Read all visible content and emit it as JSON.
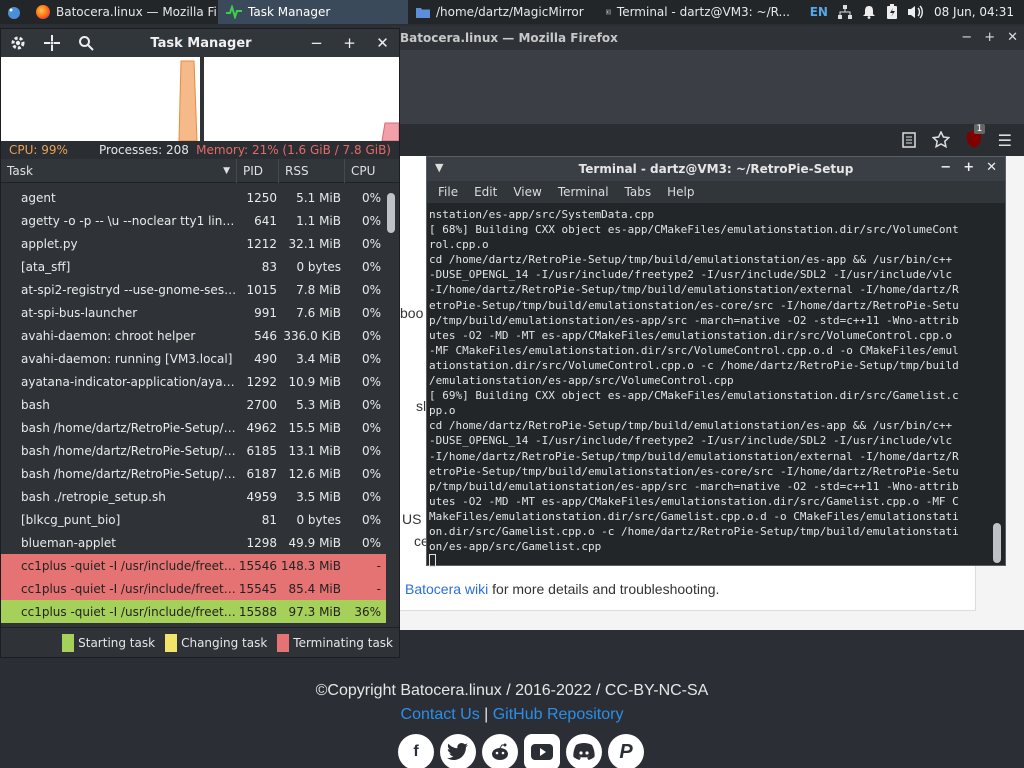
{
  "panel": {
    "tasks": [
      {
        "label": "Batocera.linux — Mozilla Fi...",
        "icon": "firefox-icon",
        "active": false
      },
      {
        "label": "Task Manager",
        "icon": "task-manager-icon",
        "active": true
      },
      {
        "label": "/home/dartz/MagicMirror",
        "icon": "folder-icon",
        "active": false
      },
      {
        "label": "Terminal - dartz@VM3: ~/R...",
        "icon": "terminal-icon",
        "active": false
      }
    ],
    "language": "EN",
    "clock": "08 Jun, 04:31"
  },
  "firefox": {
    "title": "Batocera.linux — Mozilla Firefox",
    "extension_badge": "1",
    "fragments": {
      "boo": "boo",
      "sl": "sl",
      "us": "US",
      "cew": "ce w",
      "link_text": "Batocera wiki",
      "after_link": " for more details and troubleshooting."
    },
    "footer": {
      "copyright": "©Copyright Batocera.linux / 2016-2022 / CC-BY-NC-SA",
      "contact": "Contact Us",
      "separator": " | ",
      "github": "GitHub Repository"
    }
  },
  "taskmanager": {
    "title": "Task Manager",
    "stats": {
      "cpu": "CPU: 99%",
      "processes": "Processes: 208",
      "memory": "Memory: 21% (1.6 GiB / 7.8 GiB)"
    },
    "columns": {
      "task": "Task",
      "pid": "PID",
      "rss": "RSS",
      "cpu": "CPU"
    },
    "rows": [
      {
        "task": "agent",
        "pid": "1250",
        "rss": "5.1 MiB",
        "cpu": "0%",
        "state": ""
      },
      {
        "task": "agetty -o -p -- \\u --noclear tty1 linux",
        "pid": "641",
        "rss": "1.1 MiB",
        "cpu": "0%",
        "state": ""
      },
      {
        "task": "applet.py",
        "pid": "1212",
        "rss": "32.1 MiB",
        "cpu": "0%",
        "state": ""
      },
      {
        "task": "[ata_sff]",
        "pid": "83",
        "rss": "0 bytes",
        "cpu": "0%",
        "state": ""
      },
      {
        "task": "at-spi2-registryd --use-gnome-session",
        "pid": "1015",
        "rss": "7.8 MiB",
        "cpu": "0%",
        "state": ""
      },
      {
        "task": "at-spi-bus-launcher",
        "pid": "991",
        "rss": "7.6 MiB",
        "cpu": "0%",
        "state": ""
      },
      {
        "task": "avahi-daemon: chroot helper",
        "pid": "546",
        "rss": "336.0 KiB",
        "cpu": "0%",
        "state": ""
      },
      {
        "task": "avahi-daemon: running [VM3.local]",
        "pid": "490",
        "rss": "3.4 MiB",
        "cpu": "0%",
        "state": ""
      },
      {
        "task": "ayatana-indicator-application/ayata...",
        "pid": "1292",
        "rss": "10.9 MiB",
        "cpu": "0%",
        "state": ""
      },
      {
        "task": "bash",
        "pid": "2700",
        "rss": "5.3 MiB",
        "cpu": "0%",
        "state": ""
      },
      {
        "task": "bash /home/dartz/RetroPie-Setup/re...",
        "pid": "4962",
        "rss": "15.5 MiB",
        "cpu": "0%",
        "state": ""
      },
      {
        "task": "bash /home/dartz/RetroPie-Setup/re...",
        "pid": "6185",
        "rss": "13.1 MiB",
        "cpu": "0%",
        "state": ""
      },
      {
        "task": "bash /home/dartz/RetroPie-Setup/re...",
        "pid": "6187",
        "rss": "12.6 MiB",
        "cpu": "0%",
        "state": ""
      },
      {
        "task": "bash ./retropie_setup.sh",
        "pid": "4959",
        "rss": "3.5 MiB",
        "cpu": "0%",
        "state": ""
      },
      {
        "task": "[blkcg_punt_bio]",
        "pid": "81",
        "rss": "0 bytes",
        "cpu": "0%",
        "state": ""
      },
      {
        "task": "blueman-applet",
        "pid": "1298",
        "rss": "49.9 MiB",
        "cpu": "0%",
        "state": ""
      },
      {
        "task": "cc1plus -quiet -I /usr/include/freetyp...",
        "pid": "15546",
        "rss": "148.3 MiB",
        "cpu": "-",
        "state": "red"
      },
      {
        "task": "cc1plus -quiet -I /usr/include/freetyp...",
        "pid": "15545",
        "rss": "85.4 MiB",
        "cpu": "-",
        "state": "red"
      },
      {
        "task": "cc1plus -quiet -I /usr/include/freetyp...",
        "pid": "15588",
        "rss": "97.3 MiB",
        "cpu": "36%",
        "state": "green"
      }
    ],
    "legend": {
      "starting": "Starting task",
      "changing": "Changing task",
      "terminating": "Terminating task"
    },
    "colors": {
      "starting": "#a5d15a",
      "changing": "#f2e46a",
      "terminating": "#e57373",
      "cpu_graph": "#f5b98a",
      "mem_graph": "#f2a0a8"
    }
  },
  "terminal": {
    "title": "Terminal - dartz@VM3: ~/RetroPie-Setup",
    "menu": [
      "File",
      "Edit",
      "View",
      "Terminal",
      "Tabs",
      "Help"
    ],
    "lines": [
      "nstation/es-app/src/SystemData.cpp",
      "[ 68%] Building CXX object es-app/CMakeFiles/emulationstation.dir/src/VolumeCont",
      "rol.cpp.o",
      "cd /home/dartz/RetroPie-Setup/tmp/build/emulationstation/es-app && /usr/bin/c++",
      "-DUSE_OPENGL_14 -I/usr/include/freetype2 -I/usr/include/SDL2 -I/usr/include/vlc",
      "-I/home/dartz/RetroPie-Setup/tmp/build/emulationstation/external -I/home/dartz/R",
      "etroPie-Setup/tmp/build/emulationstation/es-core/src -I/home/dartz/RetroPie-Setu",
      "p/tmp/build/emulationstation/es-app/src -march=native -O2 -std=c++11 -Wno-attrib",
      "utes -O2 -MD -MT es-app/CMakeFiles/emulationstation.dir/src/VolumeControl.cpp.o",
      "-MF CMakeFiles/emulationstation.dir/src/VolumeControl.cpp.o.d -o CMakeFiles/emul",
      "ationstation.dir/src/VolumeControl.cpp.o -c /home/dartz/RetroPie-Setup/tmp/build",
      "/emulationstation/es-app/src/VolumeControl.cpp",
      "[ 69%] Building CXX object es-app/CMakeFiles/emulationstation.dir/src/Gamelist.c",
      "pp.o",
      "cd /home/dartz/RetroPie-Setup/tmp/build/emulationstation/es-app && /usr/bin/c++",
      "-DUSE_OPENGL_14 -I/usr/include/freetype2 -I/usr/include/SDL2 -I/usr/include/vlc",
      "-I/home/dartz/RetroPie-Setup/tmp/build/emulationstation/external -I/home/dartz/R",
      "etroPie-Setup/tmp/build/emulationstation/es-core/src -I/home/dartz/RetroPie-Setu",
      "p/tmp/build/emulationstation/es-app/src -march=native -O2 -std=c++11 -Wno-attrib",
      "utes -O2 -MD -MT es-app/CMakeFiles/emulationstation.dir/src/Gamelist.cpp.o -MF C",
      "MakeFiles/emulationstation.dir/src/Gamelist.cpp.o.d -o CMakeFiles/emulationstati",
      "on.dir/src/Gamelist.cpp.o -c /home/dartz/RetroPie-Setup/tmp/build/emulationstati",
      "on/es-app/src/Gamelist.cpp"
    ]
  }
}
